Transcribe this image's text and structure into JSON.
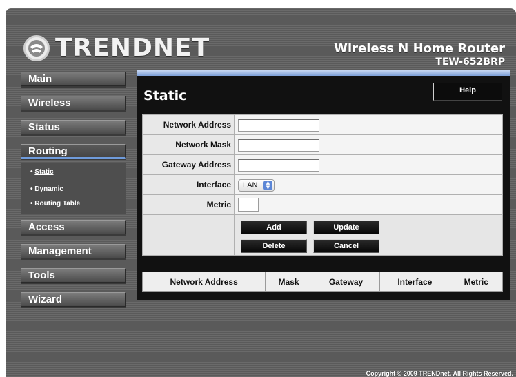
{
  "brand": {
    "logo_text": "TRENDNET",
    "logo_icon": "trendnet-logo-icon"
  },
  "header": {
    "product_title": "Wireless N Home Router",
    "product_model": "TEW-652BRP"
  },
  "nav": {
    "items": [
      {
        "label": "Main"
      },
      {
        "label": "Wireless"
      },
      {
        "label": "Status"
      },
      {
        "label": "Routing"
      },
      {
        "label": "Access"
      },
      {
        "label": "Management"
      },
      {
        "label": "Tools"
      },
      {
        "label": "Wizard"
      }
    ],
    "active": "Routing",
    "submenu": [
      {
        "label": "Static"
      },
      {
        "label": "Dynamic"
      },
      {
        "label": "Routing Table"
      }
    ],
    "submenu_active": "Static"
  },
  "panel": {
    "title": "Static",
    "help_label": "Help",
    "form": {
      "network_address": {
        "label": "Network Address",
        "value": ""
      },
      "network_mask": {
        "label": "Network Mask",
        "value": ""
      },
      "gateway_address": {
        "label": "Gateway Address",
        "value": ""
      },
      "interface": {
        "label": "Interface",
        "value": "LAN"
      },
      "metric": {
        "label": "Metric",
        "value": ""
      }
    },
    "buttons": {
      "add": "Add",
      "update": "Update",
      "delete": "Delete",
      "cancel": "Cancel"
    },
    "table": {
      "columns": [
        "Network Address",
        "Mask",
        "Gateway",
        "Interface",
        "Metric"
      ],
      "rows": []
    }
  },
  "footer": {
    "copyright": "Copyright © 2009 TRENDnet. All Rights Reserved."
  },
  "colors": {
    "accent": "#6f9bdb",
    "panel_bg": "#111111",
    "frame_bg": "#5e5e5e"
  }
}
